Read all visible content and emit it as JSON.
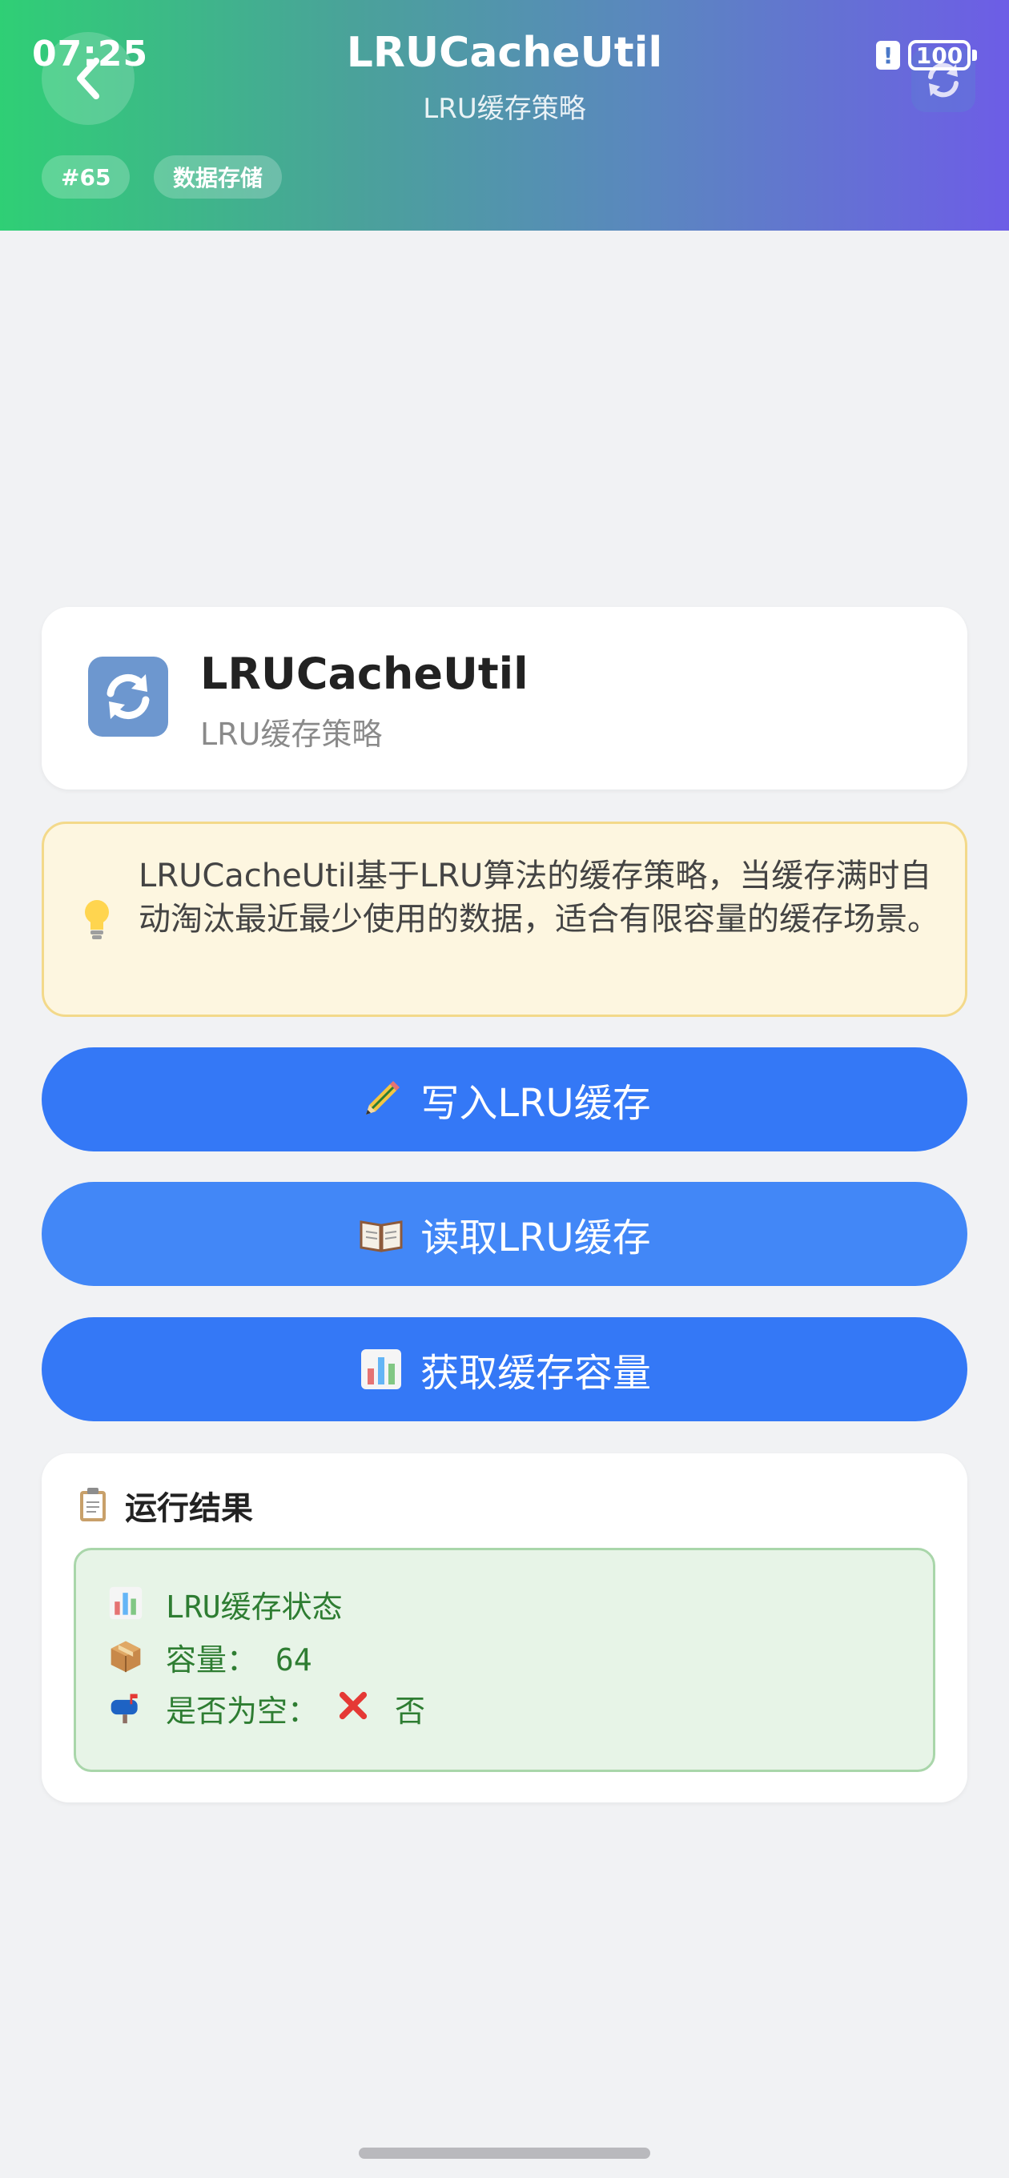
{
  "status_bar": {
    "time": "07:25",
    "alert_glyph": "!",
    "battery": "100"
  },
  "header": {
    "title": "LRUCacheUtil",
    "subtitle": "LRU缓存策略",
    "tags": [
      "#65",
      "数据存储"
    ]
  },
  "title_card": {
    "name": "LRUCacheUtil",
    "subtitle": "LRU缓存策略",
    "icon": "refresh-arrows-icon"
  },
  "info": {
    "icon": "lightbulb-icon",
    "text": "LRUCacheUtil基于LRU算法的缓存策略，当缓存满时自动淘汰最近最少使用的数据，适合有限容量的缓存场景。"
  },
  "buttons": {
    "write": "写入LRU缓存",
    "read": "读取LRU缓存",
    "capacity": "获取缓存容量"
  },
  "result": {
    "title": "运行结果",
    "lines": [
      {
        "icon": "bar-chart-icon",
        "text": "LRU缓存状态"
      },
      {
        "icon": "package-icon",
        "text": "容量： 64"
      },
      {
        "icon": "mailbox-icon",
        "label": "是否为空：",
        "value": "否"
      }
    ]
  },
  "colors": {
    "button_blue": "#3478f6",
    "result_green": "#2e7d32",
    "info_bg": "#fdf6e0"
  }
}
